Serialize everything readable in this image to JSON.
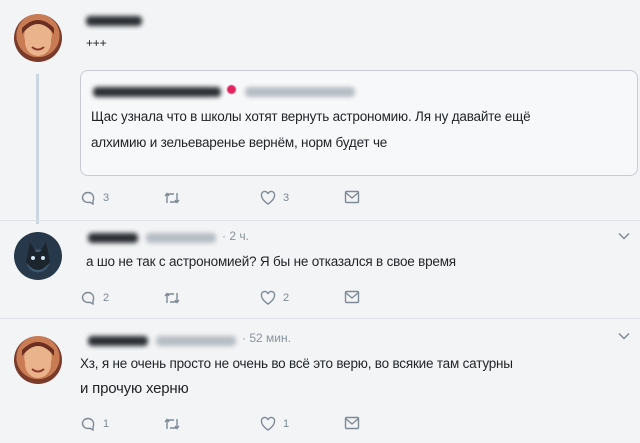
{
  "tweet1": {
    "text": "+++",
    "reply_count": "3",
    "like_count": "3",
    "quote": {
      "text_line1": "Щас узнала что в школы хотят вернуть астрономию. Ля ну давайте ещё",
      "text_line2": "алхимию и зельеваренье вернём, норм будет че"
    }
  },
  "tweet2": {
    "time": "· 2 ч.",
    "text": "а шо не так с астрономией? Я бы не отказался в свое время",
    "reply_count": "2",
    "like_count": "2"
  },
  "tweet3": {
    "time": "· 52 мин.",
    "text_line1": "Хз, я не очень просто не очень во всё это верю, во всякие там сатурны",
    "text_line2": "и прочую херню",
    "reply_count": "1",
    "like_count": "1"
  },
  "icons": {
    "reply": "reply-icon",
    "retweet": "retweet-icon",
    "like": "heart-icon",
    "message": "mail-icon",
    "more": "chevron-down-icon"
  },
  "colors": {
    "icon": "#7d8a96",
    "thread_line": "#c9d6e3",
    "blur_name": "#2b2f33"
  }
}
